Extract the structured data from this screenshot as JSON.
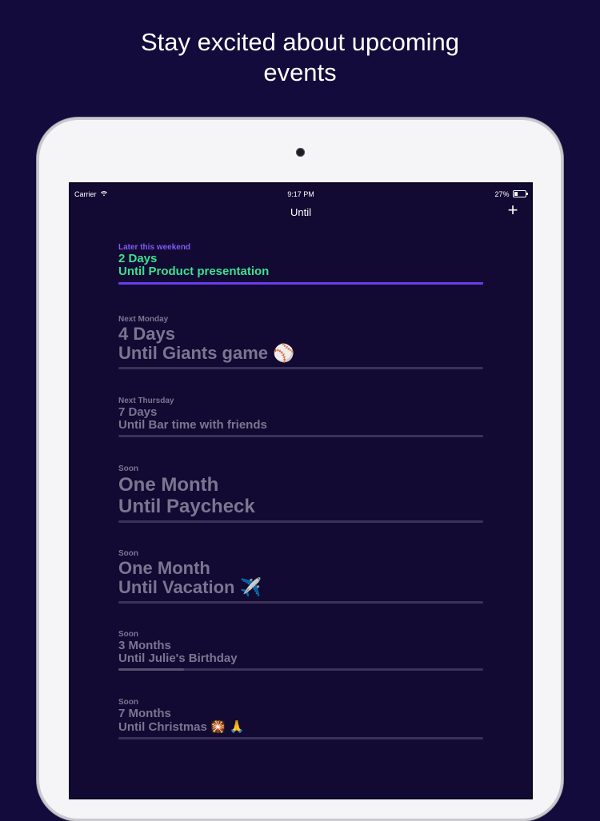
{
  "headline": {
    "line1": "Stay excited about upcoming",
    "line2": "events"
  },
  "status_bar": {
    "carrier": "Carrier",
    "time": "9:17 PM",
    "battery": "27%",
    "battery_level": 0.27
  },
  "nav": {
    "title": "Until",
    "add_label": "+"
  },
  "events": [
    {
      "when": "Later this weekend",
      "count": "2 Days",
      "title": "Until Product presentation",
      "emoji": "",
      "progress": 1.0
    },
    {
      "when": "Next Monday",
      "count": "4 Days",
      "title": "Until Giants game",
      "emoji": "⚾",
      "progress": 0.0
    },
    {
      "when": "Next Thursday",
      "count": "7 Days",
      "title": "Until Bar time with friends",
      "emoji": "",
      "progress": 0.0
    },
    {
      "when": "Soon",
      "count": "One Month",
      "title": "Until Paycheck",
      "emoji": "",
      "progress": 0.0
    },
    {
      "when": "Soon",
      "count": "One Month",
      "title": "Until Vacation",
      "emoji": "✈️",
      "progress": 0.0
    },
    {
      "when": "Soon",
      "count": "3 Months",
      "title": "Until Julie's Birthday",
      "emoji": "",
      "progress": 0.18
    },
    {
      "when": "Soon",
      "count": "7 Months",
      "title": "Until Christmas",
      "emoji": "🎇 🙏",
      "progress": 0.0
    }
  ],
  "colors": {
    "background": "#130b3b",
    "screen": "#120a33",
    "highlight_text": "#3ce08f",
    "highlight_label": "#7e5cf5",
    "highlight_bar": "#6b3cf0",
    "muted_text": "#7a7690"
  }
}
